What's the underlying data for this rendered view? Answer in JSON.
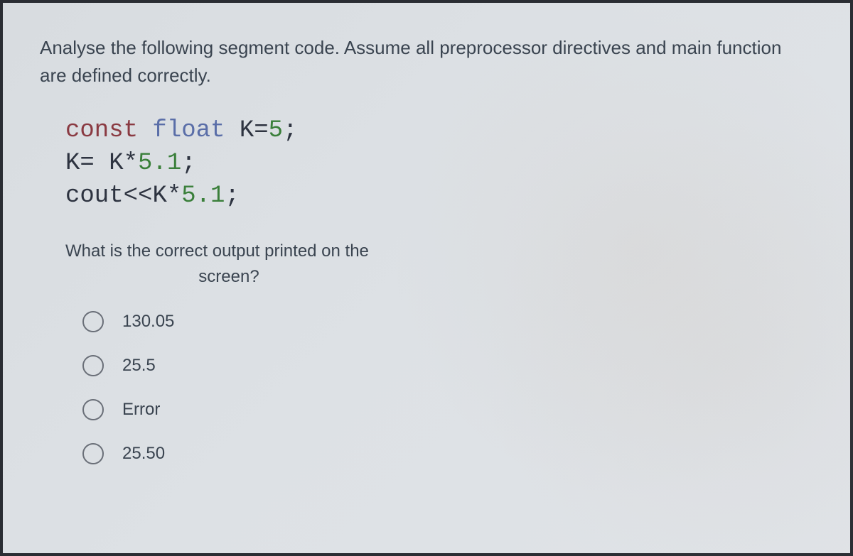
{
  "instruction": "Analyse the following segment code. Assume all preprocessor directives and main function are defined correctly.",
  "code": {
    "line1": {
      "const": "const",
      "type": " float",
      "rest": " K",
      "eq": "=",
      "num": "5",
      "semi": ";"
    },
    "line2": {
      "lhs": "K",
      "eq": "= ",
      "rhs_var": "K",
      "op": "*",
      "num": "5.1",
      "semi": ";"
    },
    "line3": {
      "cout": "cout",
      "ins": "<<",
      "var": "K",
      "op": "*",
      "num": "5.1",
      "semi": ";"
    }
  },
  "sub_question_l1": "What is the correct output printed on the",
  "sub_question_l2": "screen?",
  "options": [
    {
      "label": "130.05"
    },
    {
      "label": "25.5"
    },
    {
      "label": "Error"
    },
    {
      "label": "25.50"
    }
  ]
}
